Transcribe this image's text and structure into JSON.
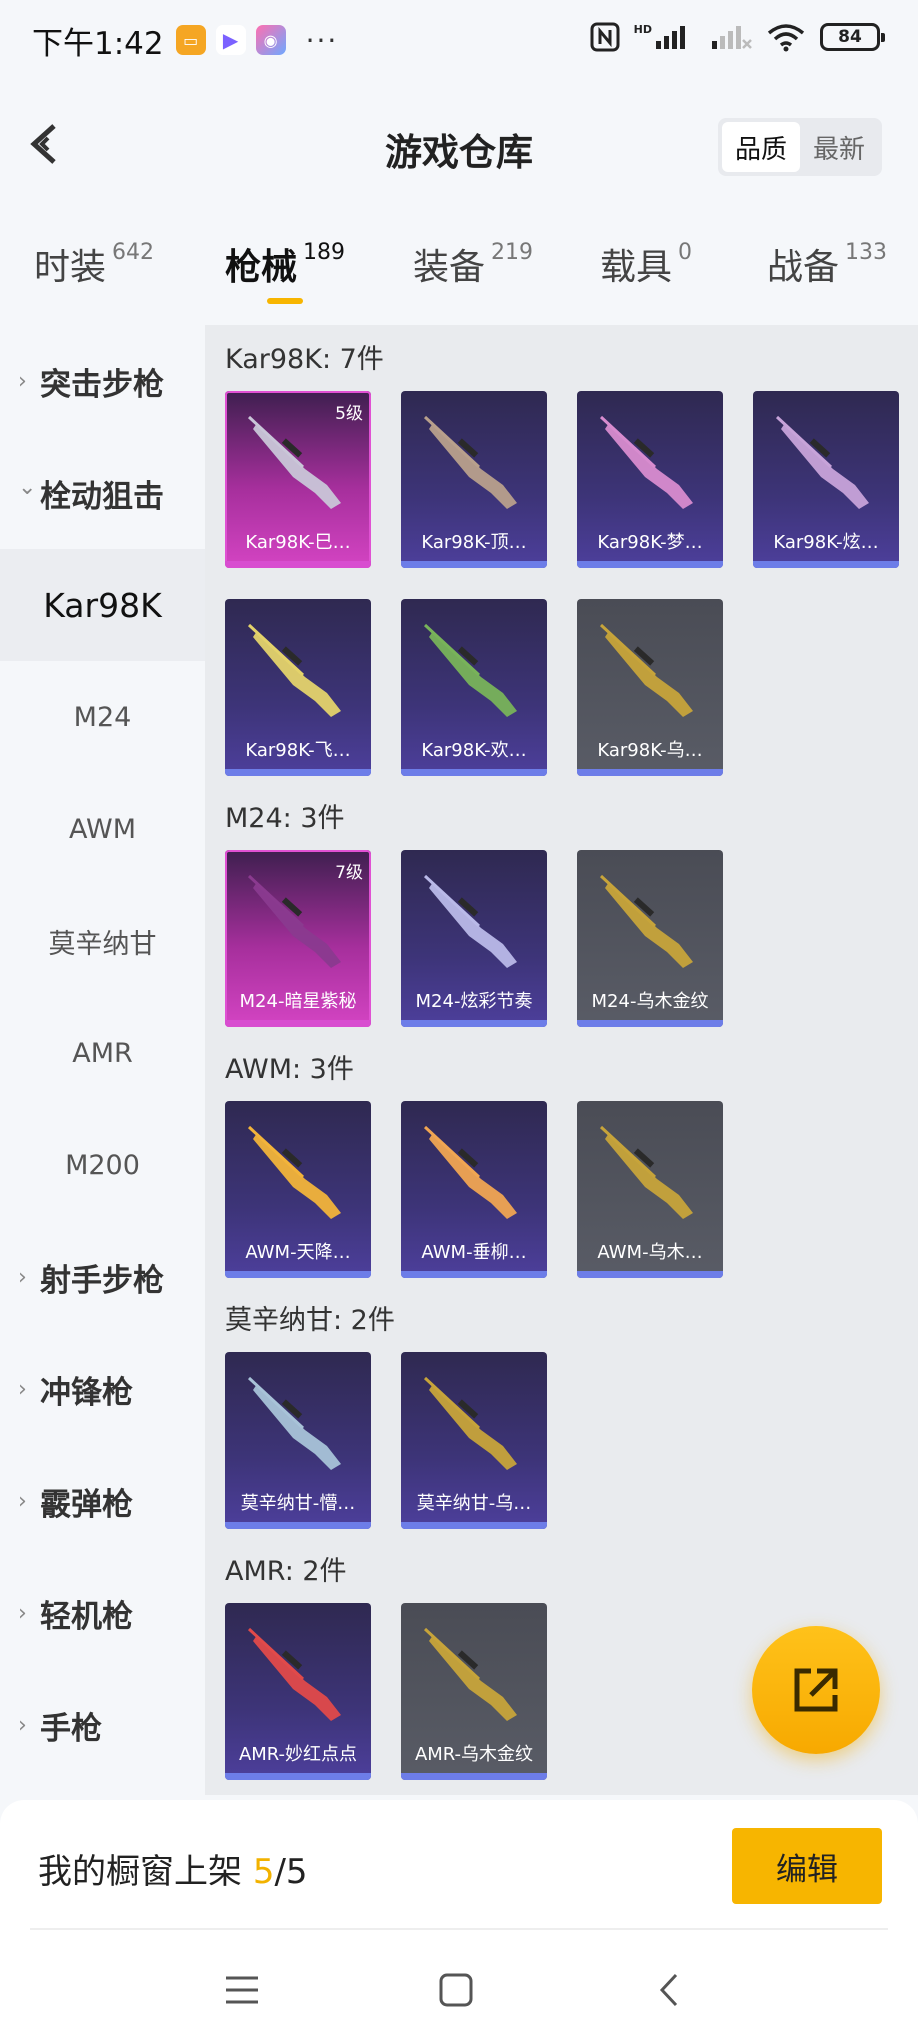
{
  "status": {
    "time": "下午1:42",
    "dots": "···",
    "battery": "84",
    "network": "HD"
  },
  "header": {
    "title": "游戏仓库",
    "sort_options": [
      "品质",
      "最新"
    ]
  },
  "tabs": [
    {
      "label": "时装",
      "count": "642"
    },
    {
      "label": "枪械",
      "count": "189"
    },
    {
      "label": "装备",
      "count": "219"
    },
    {
      "label": "载具",
      "count": "0"
    },
    {
      "label": "战备",
      "count": "133"
    }
  ],
  "sidebar": {
    "chevron_right": "›",
    "chevron_down": "⌄",
    "items": [
      {
        "label": "突击步枪",
        "type": "cat"
      },
      {
        "label": "栓动狙击",
        "type": "cat-open"
      },
      {
        "label": "Kar98K",
        "type": "sub-active"
      },
      {
        "label": "M24",
        "type": "sub"
      },
      {
        "label": "AWM",
        "type": "sub"
      },
      {
        "label": "莫辛纳甘",
        "type": "sub"
      },
      {
        "label": "AMR",
        "type": "sub"
      },
      {
        "label": "M200",
        "type": "sub"
      },
      {
        "label": "射手步枪",
        "type": "cat"
      },
      {
        "label": "冲锋枪",
        "type": "cat"
      },
      {
        "label": "霰弹枪",
        "type": "cat"
      },
      {
        "label": "轻机枪",
        "type": "cat"
      },
      {
        "label": "手枪",
        "type": "cat"
      }
    ]
  },
  "groups": [
    {
      "title": "Kar98K: 7件",
      "cards": [
        {
          "label": "Kar98K-巳…",
          "rarity": "pink",
          "level": "5级",
          "gun_color": "#c9c6d8"
        },
        {
          "label": "Kar98K-顶…",
          "rarity": "purple",
          "level": "",
          "gun_color": "#b8a08c"
        },
        {
          "label": "Kar98K-梦…",
          "rarity": "purple",
          "level": "",
          "gun_color": "#d88ccf"
        },
        {
          "label": "Kar98K-炫…",
          "rarity": "purple",
          "level": "",
          "gun_color": "#c7a3d9"
        },
        {
          "label": "Kar98K-飞…",
          "rarity": "purple",
          "level": "",
          "gun_color": "#e4d36b"
        },
        {
          "label": "Kar98K-欢…",
          "rarity": "purple",
          "level": "",
          "gun_color": "#78b35a"
        },
        {
          "label": "Kar98K-乌…",
          "rarity": "gray",
          "level": "",
          "gun_color": "#c7a43a"
        }
      ]
    },
    {
      "title": "M24: 3件",
      "cards": [
        {
          "label": "M24-暗星紫秘",
          "rarity": "pink",
          "level": "7级",
          "gun_color": "#8a3a8f"
        },
        {
          "label": "M24-炫彩节奏",
          "rarity": "purple",
          "level": "",
          "gun_color": "#b9b9e8"
        },
        {
          "label": "M24-乌木金纹",
          "rarity": "gray",
          "level": "",
          "gun_color": "#c7a43a"
        }
      ]
    },
    {
      "title": "AWM: 3件",
      "cards": [
        {
          "label": "AWM-天降…",
          "rarity": "purple",
          "level": "",
          "gun_color": "#f2b43a"
        },
        {
          "label": "AWM-垂柳…",
          "rarity": "purple",
          "level": "",
          "gun_color": "#f0a552"
        },
        {
          "label": "AWM-乌木…",
          "rarity": "gray",
          "level": "",
          "gun_color": "#c7a43a"
        }
      ]
    },
    {
      "title": "莫辛纳甘: 2件",
      "cards": [
        {
          "label": "莫辛纳甘-懵…",
          "rarity": "purple",
          "level": "",
          "gun_color": "#a8c3d8"
        },
        {
          "label": "莫辛纳甘-乌…",
          "rarity": "purple",
          "level": "",
          "gun_color": "#c7a43a"
        }
      ]
    },
    {
      "title": "AMR: 2件",
      "cards": [
        {
          "label": "AMR-妙红点点",
          "rarity": "purple",
          "level": "",
          "gun_color": "#e04a4a"
        },
        {
          "label": "AMR-乌木金纹",
          "rarity": "gray",
          "level": "",
          "gun_color": "#c7a43a"
        }
      ]
    }
  ],
  "showcase": {
    "label": "我的橱窗上架 ",
    "current": "5",
    "total": "/5",
    "edit_label": "编辑"
  },
  "colors": {
    "accent": "#f7b500",
    "rarity_pink": "#d444c3",
    "rarity_purple": "#4d3f9c",
    "rarity_gray": "#595c66"
  },
  "icons": {
    "back": "back-arrow-icon",
    "share": "share-external-icon",
    "nav_menu": "menu-icon",
    "nav_home": "home-square-icon",
    "nav_back": "back-chevron-icon"
  }
}
